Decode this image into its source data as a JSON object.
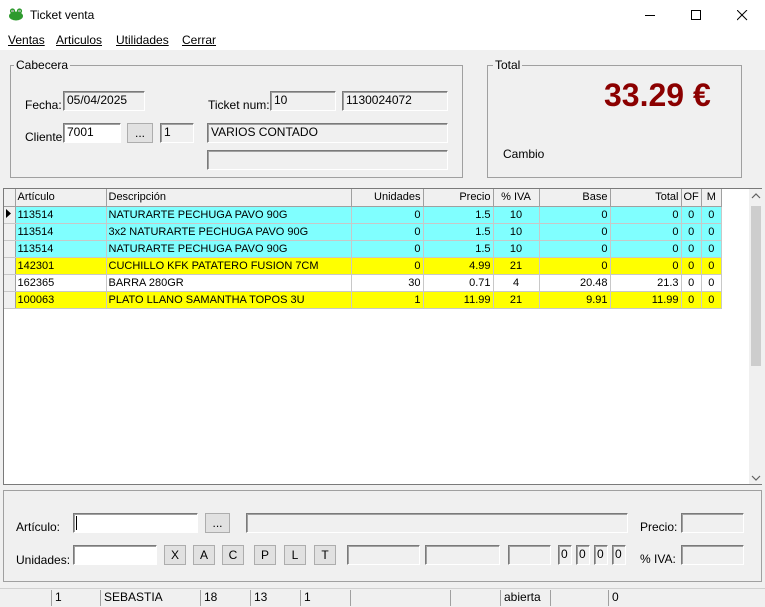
{
  "window": {
    "title": "Ticket venta",
    "icon": "frog-icon",
    "controls": [
      "minimize-icon",
      "maximize-icon",
      "close-icon"
    ]
  },
  "menu": [
    {
      "label": "Ventas"
    },
    {
      "label": "Articulos"
    },
    {
      "label": "Utilidades"
    },
    {
      "label": "Cerrar"
    }
  ],
  "cabecera": {
    "group_label": "Cabecera",
    "fecha_label": "Fecha:",
    "fecha_value": "05/04/2025",
    "ticket_label": "Ticket num:",
    "ticket_num": "10",
    "ticket_code": "1130024072",
    "cliente_label": "Cliente",
    "cliente_value": "7001",
    "browse_label": "...",
    "cliente_code": "1",
    "cliente_name": "VARIOS CONTADO",
    "extra_value": ""
  },
  "total": {
    "group_label": "Total",
    "value": "33.29 €",
    "cambio_label": "Cambio"
  },
  "grid": {
    "columns": [
      "Artículo",
      "Descripción",
      "Unidades",
      "Precio",
      "% IVA",
      "Base",
      "Total",
      "OF",
      "M"
    ],
    "rows": [
      {
        "articulo": "113514",
        "descripcion": "NATURARTE PECHUGA PAVO 90G",
        "unidades": "0",
        "precio": "1.5",
        "iva": "10",
        "base": "0",
        "total": "0",
        "of": "0",
        "m": "0",
        "color": "cyan",
        "current": true
      },
      {
        "articulo": "113514",
        "descripcion": "3x2 NATURARTE PECHUGA PAVO 90G",
        "unidades": "0",
        "precio": "1.5",
        "iva": "10",
        "base": "0",
        "total": "0",
        "of": "0",
        "m": "0",
        "color": "cyan",
        "current": false
      },
      {
        "articulo": "113514",
        "descripcion": "NATURARTE PECHUGA PAVO 90G",
        "unidades": "0",
        "precio": "1.5",
        "iva": "10",
        "base": "0",
        "total": "0",
        "of": "0",
        "m": "0",
        "color": "cyan",
        "current": false
      },
      {
        "articulo": "142301",
        "descripcion": "CUCHILLO KFK PATATERO FUSION 7CM",
        "unidades": "0",
        "precio": "4.99",
        "iva": "21",
        "base": "0",
        "total": "0",
        "of": "0",
        "m": "0",
        "color": "yellow",
        "current": false
      },
      {
        "articulo": "162365",
        "descripcion": "BARRA 280GR",
        "unidades": "30",
        "precio": "0.71",
        "iva": "4",
        "base": "20.48",
        "total": "21.3",
        "of": "0",
        "m": "0",
        "color": "white",
        "current": false
      },
      {
        "articulo": "100063",
        "descripcion": "PLATO LLANO SAMANTHA TOPOS 3U",
        "unidades": "1",
        "precio": "11.99",
        "iva": "21",
        "base": "9.91",
        "total": "11.99",
        "of": "0",
        "m": "0",
        "color": "yellow",
        "current": false
      }
    ]
  },
  "entry": {
    "articulo_label": "Artículo:",
    "articulo_value": "",
    "browse_label": "...",
    "precio_label": "Precio:",
    "unidades_label": "Unidades:",
    "unidades_value": "",
    "buttons": [
      "X",
      "A",
      "C",
      "P",
      "L",
      "T"
    ],
    "counters": [
      "0",
      "0",
      "0",
      "0"
    ],
    "iva_label": "% IVA:"
  },
  "status": [
    "",
    "1",
    "SEBASTIA",
    "18",
    "13",
    "1",
    "",
    "",
    "abierta",
    "",
    "0"
  ],
  "colors": {
    "cyan": "#80ffff",
    "yellow": "#ffff00",
    "total": "#8b0000"
  }
}
